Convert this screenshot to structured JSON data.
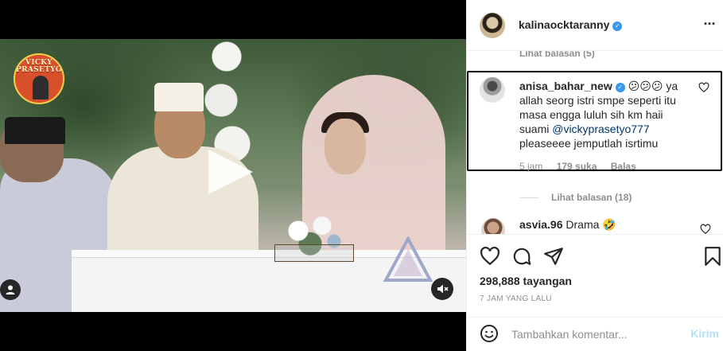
{
  "media": {
    "logo_text_line1": "VICKY",
    "logo_text_line2": "PRASETYO"
  },
  "header": {
    "username": "kalinaocktaranny",
    "verified_icon": "verified-badge-icon",
    "more_icon": "more-options-icon"
  },
  "comments": {
    "top_view_replies": "Lihat balasan (5)",
    "highlighted": {
      "username": "anisa_bahar_new",
      "emojis": "😕😕😕",
      "text_before": "ya allah seorg istri smpe seperti itu masa engga luluh sih km haii suami ",
      "mention": "@vickyprasetyo777",
      "text_after": " pleaseeee jemputlah isrtimu",
      "time": "5 jam",
      "likes": "179 suka",
      "reply": "Balas"
    },
    "view_replies": "Lihat balasan (18)",
    "second": {
      "username": "asvia.96",
      "text": "Drama 🤣"
    }
  },
  "actions": {
    "views": "298,888 tayangan",
    "time_ago": "7 JAM YANG LALU"
  },
  "add_comment": {
    "placeholder": "Tambahkan komentar...",
    "post_label": "Kirim"
  }
}
